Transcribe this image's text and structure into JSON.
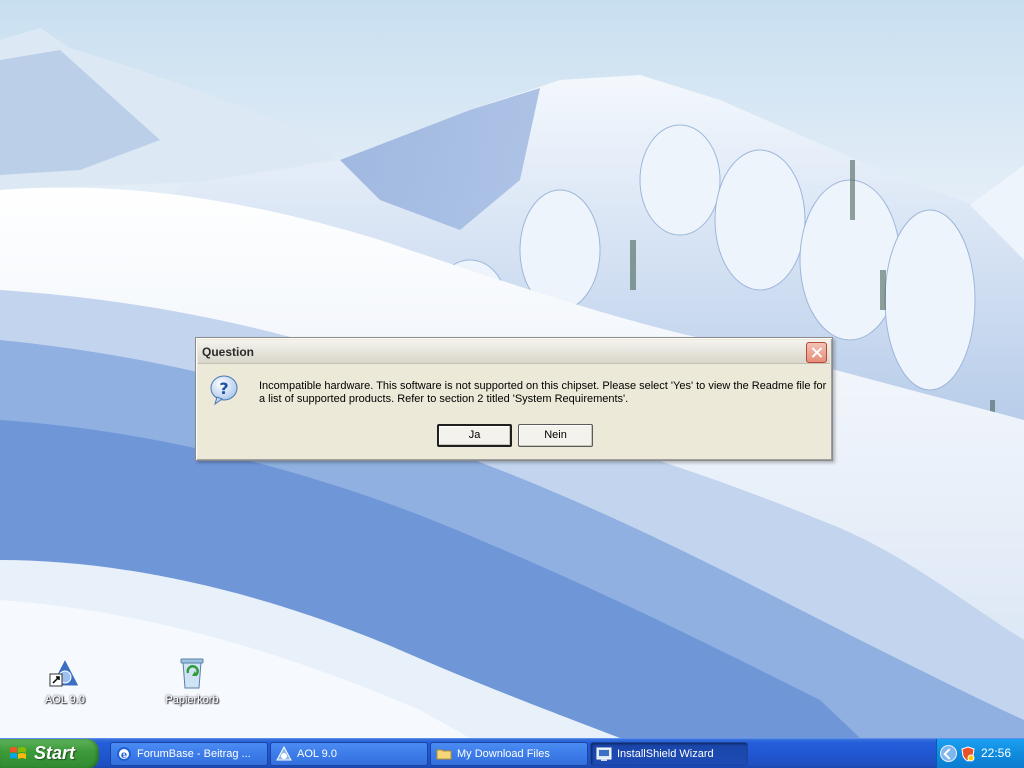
{
  "desktop": {
    "icons": [
      {
        "label": "AOL 9.0",
        "icon": "aol-icon"
      },
      {
        "label": "Papierkorb",
        "icon": "recycle-bin-icon"
      }
    ]
  },
  "dialog": {
    "title": "Question",
    "message": "Incompatible hardware. This software is not supported on this chipset.  Please select 'Yes' to view the Readme file for a list of supported products. Refer to section 2 titled 'System Requirements'.",
    "yes_label": "Ja",
    "no_label": "Nein",
    "icon": "question-icon"
  },
  "taskbar": {
    "start_label": "Start",
    "tasks": [
      {
        "label": "ForumBase - Beitrag ...",
        "icon": "ie-icon",
        "active": false
      },
      {
        "label": "AOL 9.0",
        "icon": "aol-icon",
        "active": false
      },
      {
        "label": "My Download Files",
        "icon": "folder-icon",
        "active": false
      },
      {
        "label": "InstallShield Wizard",
        "icon": "installer-icon",
        "active": true
      }
    ],
    "clock": "22:56"
  },
  "colors": {
    "taskbar_blue": "#245edb",
    "start_green": "#3d9b3a",
    "dialog_bg": "#ece9d8",
    "tray_blue": "#108bde"
  }
}
